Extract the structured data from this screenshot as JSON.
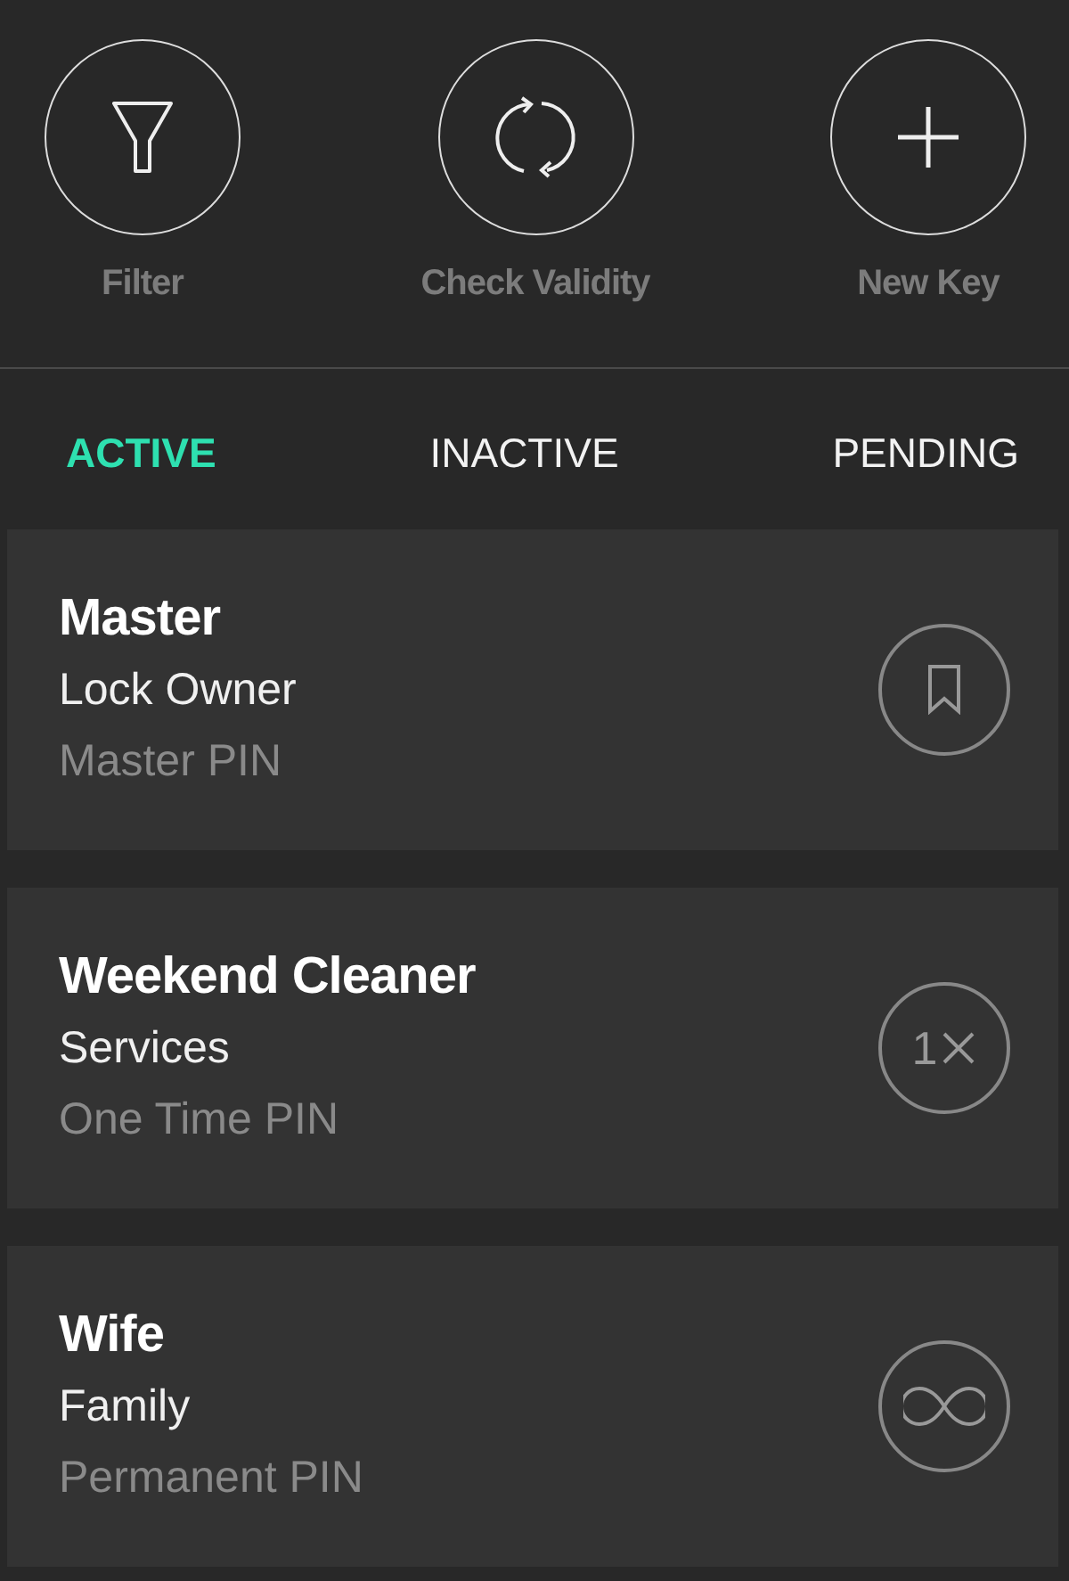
{
  "actions": [
    {
      "kind": "filter",
      "label": "Filter"
    },
    {
      "kind": "refresh",
      "label": "Check Validity"
    },
    {
      "kind": "add",
      "label": "New Key"
    }
  ],
  "tabs": [
    {
      "label": "ACTIVE",
      "selected": true
    },
    {
      "label": "INACTIVE",
      "selected": false
    },
    {
      "label": "PENDING",
      "selected": false
    }
  ],
  "keys": [
    {
      "name": "Master",
      "group": "Lock Owner",
      "type": "Master PIN",
      "kind": "bookmark"
    },
    {
      "name": "Weekend Cleaner",
      "group": "Services",
      "type": "One Time PIN",
      "kind": "once",
      "badge": "1"
    },
    {
      "name": "Wife",
      "group": "Family",
      "type": "Permanent PIN",
      "kind": "infinite"
    }
  ]
}
